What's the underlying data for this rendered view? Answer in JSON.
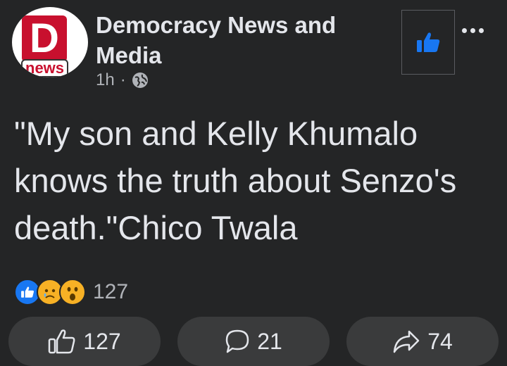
{
  "post": {
    "page_name": "Democracy News and Media",
    "avatar_letter": "D",
    "avatar_sub": "news",
    "time": "1h",
    "separator": "·",
    "privacy_icon": "globe-icon",
    "text": "\"My son and Kelly Khumalo knows the truth about Senzo's death.\"Chico Twala"
  },
  "reactions": {
    "types": [
      "like",
      "sad",
      "wow"
    ],
    "count": "127"
  },
  "actions": {
    "like_count": "127",
    "comment_count": "21",
    "share_count": "74"
  },
  "colors": {
    "background": "#242526",
    "accent": "#1877f2",
    "button_bg": "#3a3b3c",
    "brand_red": "#c8102e"
  }
}
